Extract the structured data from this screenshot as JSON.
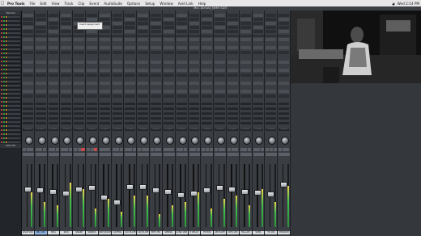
{
  "menubar": {
    "app": "Pro Tools",
    "items": [
      "File",
      "Edit",
      "View",
      "Track",
      "Clip",
      "Event",
      "AudioSuite",
      "Options",
      "Setup",
      "Window",
      "Avid Link",
      "Help"
    ],
    "clock": "Wed 2:14 PM"
  },
  "window": {
    "title": "Mix: Almost_MMM EDIT"
  },
  "tracklist": {
    "header": "TRACKS",
    "groups_header": "GROUPS",
    "rows": [
      {
        "color": "#e34b4b"
      },
      {
        "color": "#e34b4b"
      },
      {
        "color": "#e34b4b"
      },
      {
        "color": "#e34b4b"
      },
      {
        "color": "#e34b4b"
      },
      {
        "color": "#e34b4b"
      },
      {
        "color": "#e34b4b"
      },
      {
        "color": "#e34b4b"
      },
      {
        "color": "#e34b4b"
      },
      {
        "color": "#e34b4b"
      },
      {
        "color": "#e34b4b"
      },
      {
        "color": "#e34b4b"
      },
      {
        "color": "#e34b4b"
      },
      {
        "color": "#e34b4b"
      },
      {
        "color": "#e34b4b"
      },
      {
        "color": "#e34b4b"
      },
      {
        "color": "#e34b4b"
      },
      {
        "color": "#e34b4b"
      },
      {
        "color": "#e34b4b"
      },
      {
        "color": "#e34b4b"
      },
      {
        "color": "#e34b4b"
      },
      {
        "color": "#e34b4b"
      },
      {
        "color": "#e34b4b"
      },
      {
        "color": "#e34b4b"
      },
      {
        "color": "#e34b4b"
      },
      {
        "color": "#e34b4b"
      },
      {
        "color": "#e34b4b"
      },
      {
        "color": "#e34b4b"
      },
      {
        "color": "#e34b4b"
      },
      {
        "color": "#e34b4b"
      },
      {
        "color": "#e34b4b"
      },
      {
        "color": "#e34b4b"
      }
    ]
  },
  "popup": {
    "line1": "Insert Assignment",
    "line2": ""
  },
  "strips": [
    {
      "name": "LEAD VOX",
      "send_a": "",
      "send_b": "",
      "group": "no group",
      "fader": 0.62,
      "meter": 0.55,
      "selected": false
    },
    {
      "name": "DBL VOX",
      "send_a": "",
      "send_b": "",
      "group": "no group",
      "fader": 0.6,
      "meter": 0.4,
      "selected": true
    },
    {
      "name": "BKG",
      "send_a": "",
      "send_b": "",
      "group": "no group",
      "fader": 0.58,
      "meter": 0.35,
      "selected": false
    },
    {
      "name": "KICK",
      "send_a": "",
      "send_b": "",
      "group": "no group",
      "fader": 0.55,
      "meter": 0.7,
      "selected": false
    },
    {
      "name": "SNARE",
      "send_a": "",
      "send_b": "",
      "group": "no group",
      "fader": 0.62,
      "meter": 0.6,
      "selected": false
    },
    {
      "name": "SPANKS",
      "send_a": "",
      "send_b": "",
      "group": "no group",
      "fader": 0.64,
      "meter": 0.3,
      "selected": false
    },
    {
      "name": "DRM ROOM",
      "send_a": "",
      "send_b": "",
      "group": "no group",
      "fader": 0.48,
      "meter": 0.45,
      "selected": false
    },
    {
      "name": "CAPITOL",
      "send_a": "",
      "send_b": "",
      "group": "no group",
      "fader": 0.4,
      "meter": 0.25,
      "selected": false
    },
    {
      "name": "140 PLATE",
      "send_a": "",
      "send_b": "",
      "group": "no group",
      "fader": 0.66,
      "meter": 0.5,
      "selected": false
    },
    {
      "name": "140 PLATE",
      "send_a": "",
      "send_b": "",
      "group": "no group",
      "fader": 0.66,
      "meter": 0.5,
      "selected": false
    },
    {
      "name": "EMT 250",
      "send_a": "",
      "send_b": "",
      "group": "no group",
      "fader": 0.6,
      "meter": 0.2,
      "selected": false
    },
    {
      "name": "SPRING",
      "send_a": "",
      "send_b": "",
      "group": "no group",
      "fader": 0.58,
      "meter": 0.35,
      "selected": false
    },
    {
      "name": "LONG VRB",
      "send_a": "",
      "send_b": "",
      "group": "no group",
      "fader": 0.52,
      "meter": 0.4,
      "selected": false
    },
    {
      "name": "P DELAY",
      "send_a": "",
      "send_b": "",
      "group": "no group",
      "fader": 0.55,
      "meter": 0.55,
      "selected": false
    },
    {
      "name": "ECHOS",
      "send_a": "",
      "send_b": "",
      "group": "no group",
      "fader": 0.6,
      "meter": 0.3,
      "selected": false
    },
    {
      "name": "AM PLATE",
      "send_a": "",
      "send_b": "",
      "group": "no group",
      "fader": 0.64,
      "meter": 0.45,
      "selected": false
    },
    {
      "name": "CRYS LEX",
      "send_a": "",
      "send_b": "",
      "group": "no group",
      "fader": 0.62,
      "meter": 0.5,
      "selected": false
    },
    {
      "name": "HALLAM",
      "send_a": "",
      "send_b": "",
      "group": "no group",
      "fader": 0.58,
      "meter": 0.35,
      "selected": false
    },
    {
      "name": "SUBS",
      "send_a": "",
      "send_b": "",
      "group": "no group",
      "fader": 0.56,
      "meter": 0.6,
      "selected": false
    },
    {
      "name": "TK 100",
      "send_a": "",
      "send_b": "",
      "group": "no group",
      "fader": 0.54,
      "meter": 0.4,
      "selected": false
    },
    {
      "name": "MICROSH",
      "send_a": "",
      "send_b": "",
      "group": "no group",
      "fader": 0.7,
      "meter": 0.65,
      "selected": false
    }
  ],
  "send_label": "SENDS F-J",
  "colors": {
    "accent": "#8fb7e8",
    "meter_green": "#3fbf4a",
    "meter_yellow": "#f0d64a"
  }
}
